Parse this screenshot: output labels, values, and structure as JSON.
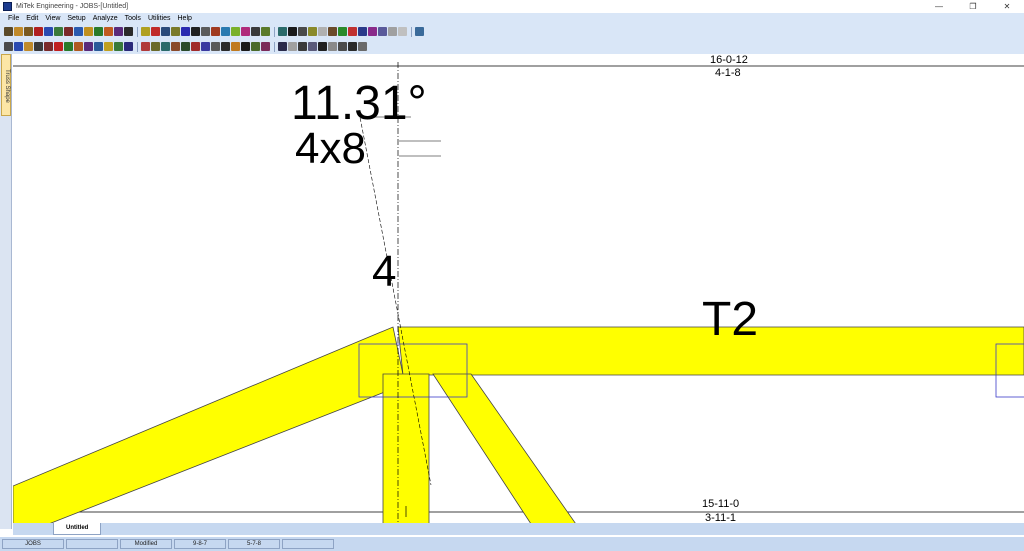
{
  "window": {
    "title": "MiTek Engineering - JOBS-[Untitled]",
    "controls": [
      "—",
      "❐",
      "✕"
    ]
  },
  "menu": [
    "File",
    "Edit",
    "View",
    "Setup",
    "Analyze",
    "Tools",
    "Utilities",
    "Help"
  ],
  "toolbar": {
    "row1_colors": [
      "#5a4a2a",
      "#c08a2a",
      "#7a5a20",
      "#b02020",
      "#2a4ab0",
      "#3a7a3a",
      "#7a2a2a",
      "#2a5ab0",
      "#c09020",
      "#2a7a2a",
      "#c05a20",
      "#5a2a7a",
      "#2a2a2a",
      "#b0a020",
      "#c02a2a",
      "#2a4a7a",
      "#7a7a2a",
      "#2a2ab0",
      "#202020",
      "#5a5a5a",
      "#a03a20",
      "#2a7ab0",
      "#7ab02a",
      "#b02a7a",
      "#3a3a3a",
      "#5a7a2a",
      "#2a6a6a",
      "#1a1a1a",
      "#4a4a4a",
      "#8a8a2a",
      "#b0b0b0",
      "#6a4a2a",
      "#2a8a2a",
      "#c03030",
      "#2a3a8a",
      "#8a2a8a",
      "#5a5a9a",
      "#a0a0a0",
      "#c0c0c0",
      "#3a6a9a"
    ],
    "row2_colors": [
      "#4a4a4a",
      "#2a4ab0",
      "#c08a2a",
      "#3a3a3a",
      "#7a2a2a",
      "#c02020",
      "#2a7a2a",
      "#b05a20",
      "#5a2a7a",
      "#2a5a9a",
      "#c0a020",
      "#3a7a3a",
      "#2a2a7a",
      "#b03a3a",
      "#6a6a2a",
      "#2a6a6a",
      "#8a4a2a",
      "#2a4a2a",
      "#a02a2a",
      "#3a3aa0",
      "#5a5a5a",
      "#2a2a2a",
      "#c07a20",
      "#1a1a1a",
      "#4a6a2a",
      "#7a2a5a",
      "#2a2a4a",
      "#a0a0a0",
      "#3a3a3a",
      "#5a5a7a",
      "#202020",
      "#8a8a8a",
      "#4a4a4a",
      "#2a2a2a",
      "#6a6a6a"
    ]
  },
  "left_panel": {
    "tab_label": "Truss Shape"
  },
  "drawing": {
    "top_dim_1": "16-0-12",
    "top_dim_2": "4-1-8",
    "angle_label": "11.31°",
    "plate_label": "4x8",
    "joint_number": "4",
    "member_label": "T2",
    "bottom_dim_1": "15-11-0",
    "bottom_dim_2": "3-11-1",
    "member_fill": "#ffff00",
    "member_stroke": "#444444",
    "plate_stroke": "#3b3bc9"
  },
  "tabs": {
    "active": "Untitled"
  },
  "status": {
    "cells": [
      "JOBS",
      "",
      "Modified",
      "9-8-7",
      "5-7-8",
      ""
    ]
  }
}
